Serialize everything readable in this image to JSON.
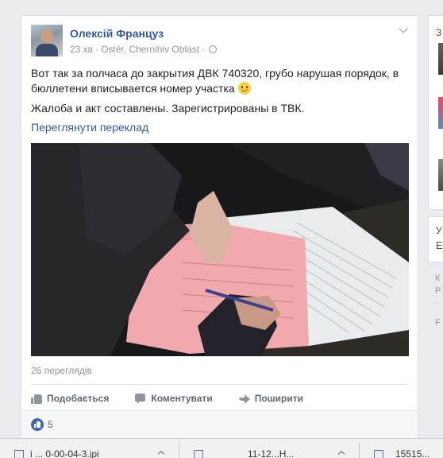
{
  "post": {
    "author": "Олексій Француз",
    "time": "23 хв",
    "location": "Ostër, Chernihiv Oblast",
    "text_1": "Вот так за полчаса до закрытия ДВК 740320, грубо нарушая порядок, в бюллетени вписывается номер участка",
    "text_2": "Жалоба и акт составлены. Зарегистрированы в ТВК.",
    "translate_link": "Переглянути переклад",
    "views": "26 переглядів",
    "actions": {
      "like": "Подобається",
      "comment": "Коментувати",
      "share": "Поширити"
    },
    "reaction_count": "5",
    "icons": {
      "privacy": "globe-icon",
      "menu": "chevron-down-icon",
      "like": "thumbs-up-icon",
      "comment": "comment-icon",
      "share": "share-arrow-icon"
    }
  },
  "right_sidebar": {
    "label_1": "З",
    "label_2": "У",
    "label_3": "Е",
    "footer_1": "К",
    "footer_2": "Р",
    "footer_3": "·",
    "footer_4": "F"
  },
  "downloads": {
    "item_1": "i  ...  0-00-04-3.jpi",
    "item_2": "11-12...H...",
    "item_3": "15515..."
  },
  "colors": {
    "link": "#365899",
    "meta": "#90949c",
    "background": "#e9ebee",
    "like_blue": "#4267b2"
  }
}
